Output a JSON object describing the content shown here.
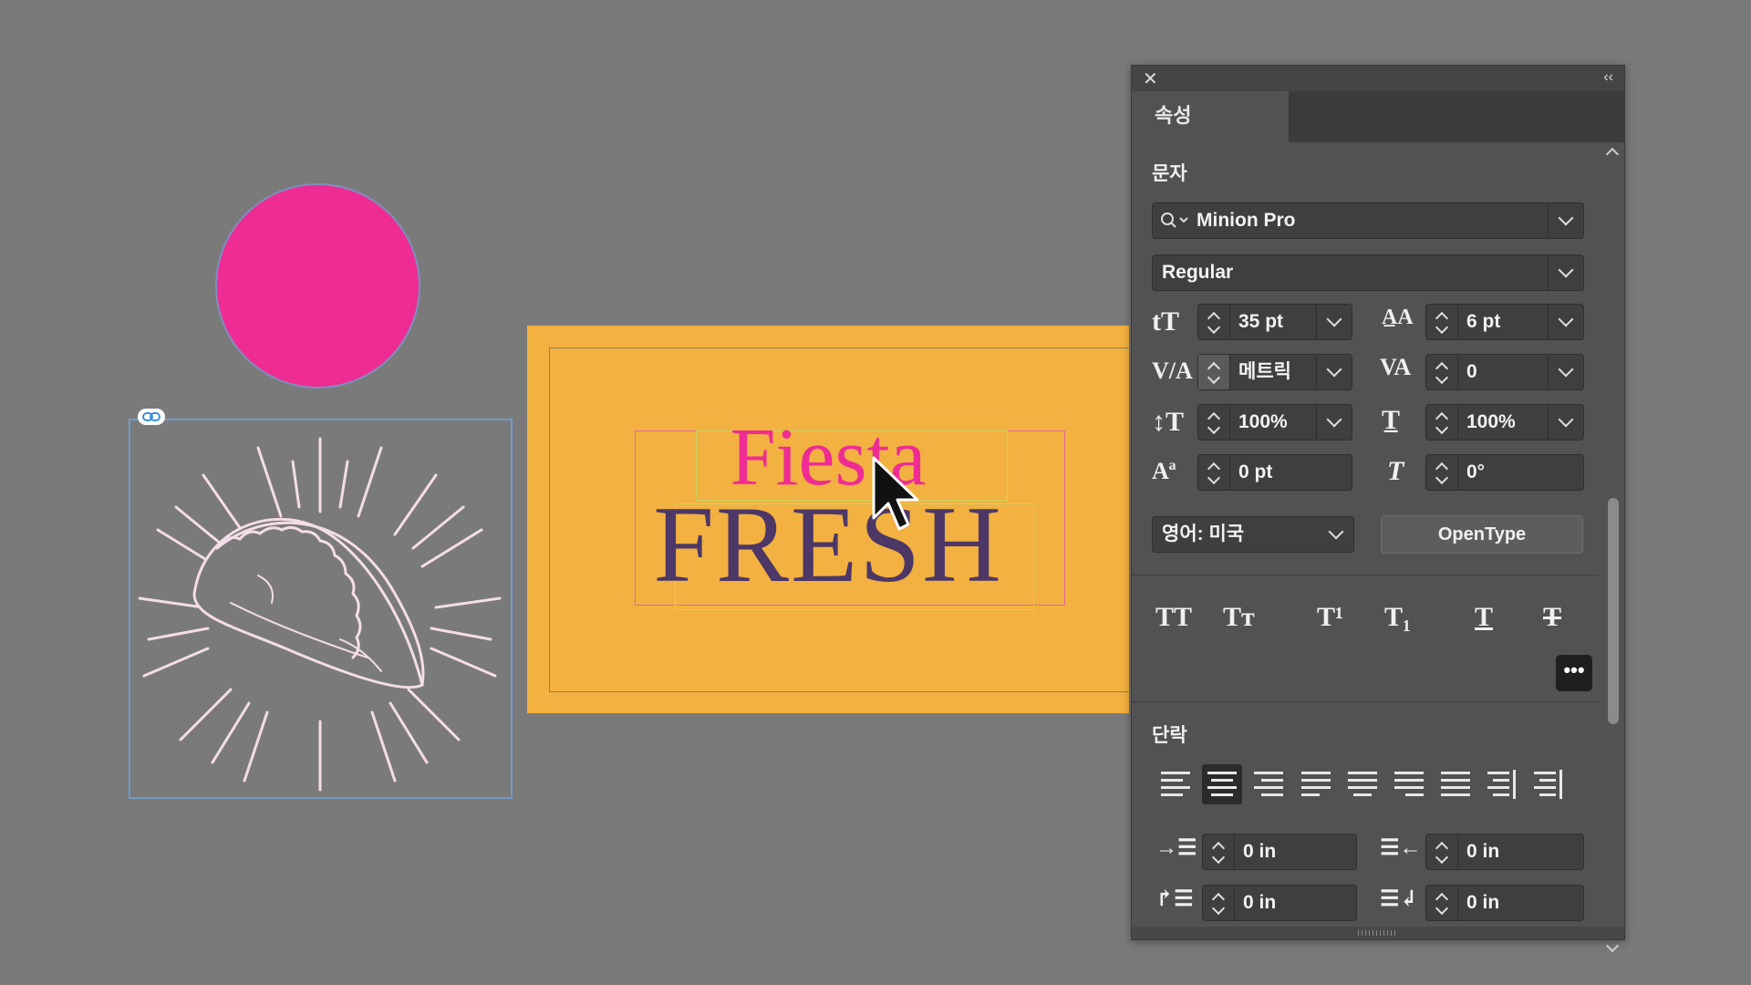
{
  "panel": {
    "tab_label": "속성",
    "character_section": "문자",
    "font_family": "Minion Pro",
    "font_style": "Regular",
    "font_size": "35 pt",
    "leading": "6 pt",
    "kerning": "메트릭",
    "tracking": "0",
    "vertical_scale": "100%",
    "horizontal_scale": "100%",
    "baseline_shift": "0 pt",
    "skew": "0°",
    "language": "영어: 미국",
    "opentype_button": "OpenType",
    "text_style_buttons": [
      "TT",
      "Tт",
      "T¹",
      "T₁",
      "T",
      "T"
    ],
    "paragraph_section": "단락",
    "alignment_options": [
      "left",
      "center",
      "right",
      "justify-left",
      "justify-center",
      "justify-right",
      "justify-all",
      "toward-spine",
      "away-from-spine"
    ],
    "selected_alignment": "center",
    "left_indent": "0 in",
    "right_indent": "0 in",
    "first_line_indent": "0 in",
    "last_line_indent": "0 in",
    "more_button": "•••"
  },
  "canvas": {
    "headline_top": "Fiesta",
    "headline_bottom": "FRESH",
    "colors": {
      "circle": "#ee2c93",
      "card": "#f2b140",
      "fiesta_text": "#ee2c93",
      "fresh_text": "#4c3767"
    }
  }
}
